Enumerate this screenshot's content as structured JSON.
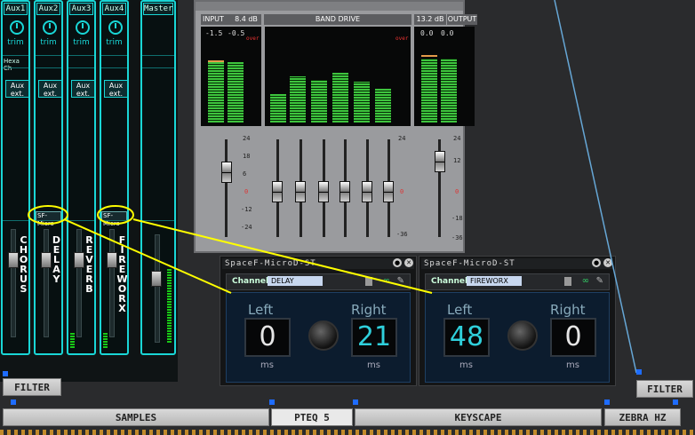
{
  "mixer": {
    "strips": [
      {
        "name": "Aux1",
        "trim": "trim",
        "aux": "Aux\next.",
        "label": "CHORUS",
        "plugin": ""
      },
      {
        "name": "Aux2",
        "trim": "trim",
        "aux": "Aux\next.",
        "label": "DELAY",
        "plugin": "SF-Micro"
      },
      {
        "name": "Aux3",
        "trim": "trim",
        "aux": "Aux\next.",
        "label": "REVERB",
        "plugin": ""
      },
      {
        "name": "Aux4",
        "trim": "trim",
        "aux": "Aux\next.",
        "label": "FIREWORX",
        "plugin": "SF-Micro"
      },
      {
        "name": "Master",
        "trim": "",
        "aux": "",
        "label": "",
        "plugin": ""
      }
    ],
    "hexa_label": "Hexa Ch"
  },
  "mainwin": {
    "input_label": "INPUT",
    "input_db": "8.4 dB",
    "band_label": "BAND DRIVE",
    "output_db": "13.2 dB",
    "output_label": "OUTPUT",
    "in_vals": [
      "-1.5",
      "-0.5"
    ],
    "out_vals": [
      "0.0",
      "0.0"
    ],
    "over": "over",
    "scale_meter": [
      "0",
      "4",
      "8",
      "12",
      "16",
      "20",
      "24",
      "30",
      "36",
      "42",
      "48",
      "54",
      "60",
      "66"
    ],
    "scale_fader": [
      "24",
      "18",
      "12",
      "6",
      "0",
      "-6",
      "-12",
      "-18",
      "-24",
      "-36"
    ]
  },
  "plugins": [
    {
      "title": "SpaceF-MicroD-ST",
      "channel_label": "Channel",
      "channel": "DELAY",
      "left_label": "Left",
      "right_label": "Right",
      "left": "0",
      "right": "21",
      "unit": "ms"
    },
    {
      "title": "SpaceF-MicroD-ST",
      "channel_label": "Channel",
      "channel": "FIREWORX",
      "left_label": "Left",
      "right_label": "Right",
      "left": "48",
      "right": "0",
      "unit": "ms"
    }
  ],
  "rack": {
    "filter_left": "FILTER",
    "filter_right": "FILTER",
    "samples": "SAMPLES",
    "pteq": "PTEQ 5",
    "keyscape": "KEYSCAPE",
    "zebra": "ZEBRA HZ"
  },
  "colors": {
    "accent": "#19d6d6",
    "highlight": "#ffff00",
    "meter": "#3ec53e"
  }
}
